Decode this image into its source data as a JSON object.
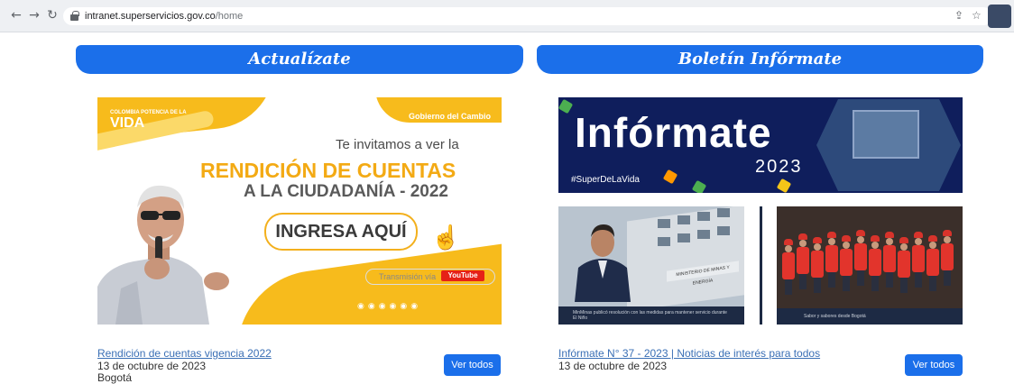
{
  "browser": {
    "url_host": "intranet.superservicios.gov.co",
    "url_path": "/home",
    "nav": {
      "back": "←",
      "forward": "→",
      "reload": "↻"
    }
  },
  "sections": [
    {
      "header": "Actualízate",
      "banner": {
        "logo_left_small": "COLOMBIA POTENCIA DE LA",
        "logo_left": "VIDA",
        "logo_right": "Gobierno del Cambio",
        "invite": "Te invitamos a ver la",
        "title": "RENDICIÓN DE CUENTAS",
        "subtitle": "A LA CIUDADANÍA - 2022",
        "cta": "INGRESA AQUÍ",
        "stream": "Transmisión vía",
        "stream_platform": "YouTube"
      },
      "link": "Rendición de cuentas vigencia 2022",
      "date": "13 de octubre de 2023",
      "place": "Bogotá",
      "button": "Ver todos"
    },
    {
      "header": "Boletín Infórmate",
      "banner": {
        "title": "Infórmate",
        "year": "2023",
        "tag": "#SuperDeLaVida",
        "photo1_caption": "MinMinas publicó resolución con las medidas para mantener servicio durante El Niño",
        "photo1_sign": "MINISTERIO DE MINAS Y ENERGÍA",
        "photo2_caption": "Sabor y sabores desde Bogotá"
      },
      "link": "Infórmate N° 37 - 2023 | Noticias de interés para todos",
      "date": "13 de octubre de 2023",
      "button": "Ver todos"
    }
  ],
  "colors": {
    "primary": "#1b6fea",
    "accent_yellow": "#f7bb1c",
    "navy": "#0f1e5c"
  }
}
